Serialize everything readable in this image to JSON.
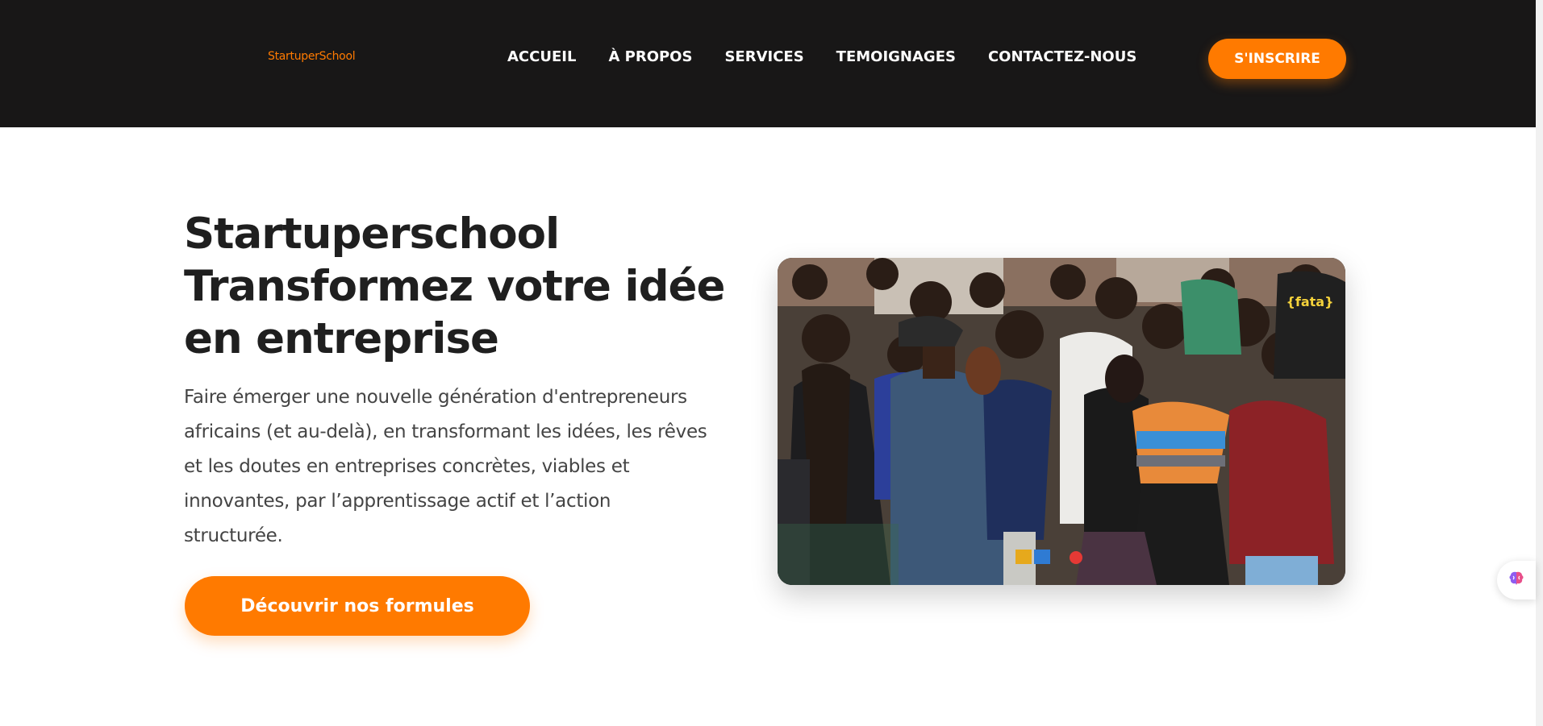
{
  "header": {
    "logo_text": "StartuperSchool",
    "nav": [
      "ACCUEIL",
      "À PROPOS",
      "SERVICES",
      "TEMOIGNAGES",
      "CONTACTEZ-NOUS"
    ],
    "signup_label": "S'INSCRIRE"
  },
  "hero": {
    "title_lines": [
      "Startuperschool",
      "Transformez votre idée",
      "en entreprise"
    ],
    "description_lines": [
      "Faire émerger une nouvelle génération d'entrepreneurs",
      "africains (et au-delà), en transformant les idées, les rêves",
      "et les doutes en entreprises concrètes, viables et",
      "innovantes, par l’apprentissage actif et l’action",
      "structurée."
    ],
    "cta_label": "Découvrir nos formules",
    "photo_shirt_label": "{fata}"
  },
  "colors": {
    "brand_orange": "#ff7a00",
    "header_bg": "#181717",
    "title_text": "#1f1f1f",
    "body_text": "#444444"
  },
  "icons": {
    "widget": "brain-icon"
  }
}
